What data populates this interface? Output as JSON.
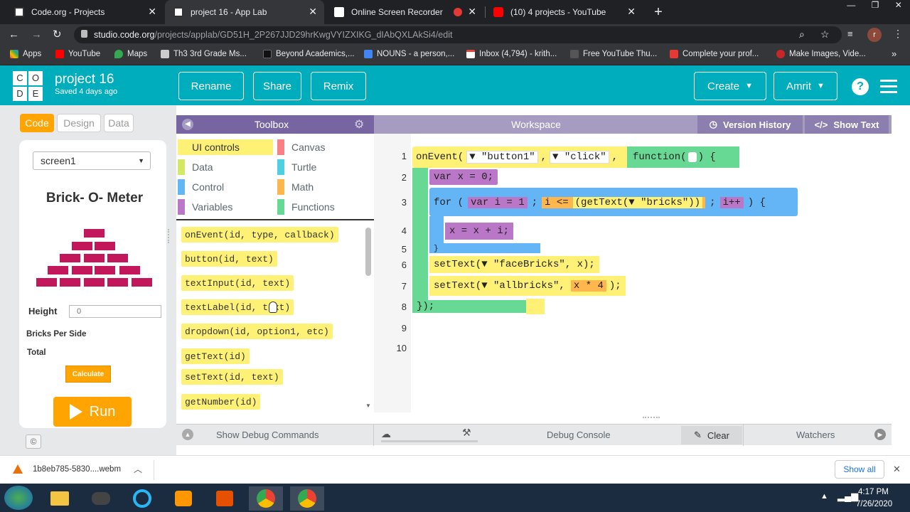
{
  "browser": {
    "tabs": [
      {
        "title": "Code.org - Projects",
        "close": "✕"
      },
      {
        "title": "project 16 - App Lab",
        "close": "✕"
      },
      {
        "title": "Online Screen Recorder",
        "close": "✕"
      },
      {
        "title": "(10) 4 projects - YouTube",
        "close": "✕"
      }
    ],
    "new_tab": "+",
    "url_host": "studio.code.org",
    "url_path": "/projects/applab/GD51H_2P267JJD29hrKwgVYIZXIKG_dIAbQXLAkSi4/edit",
    "profile_initial": "r",
    "bookmarks": [
      "Apps",
      "YouTube",
      "Maps",
      "Th3 3rd Grade Ms...",
      "Beyond Academics,...",
      "NOUNS - a person,...",
      "Inbox (4,794) - krith...",
      "Free YouTube Thu...",
      "Complete your prof...",
      "Make Images, Vide..."
    ]
  },
  "header": {
    "logo_letters": [
      "C",
      "O",
      "D",
      "E"
    ],
    "project_name": "project 16",
    "saved": "Saved 4 days ago",
    "rename": "Rename",
    "share": "Share",
    "remix": "Remix",
    "create": "Create",
    "user": "Amrit",
    "help": "?"
  },
  "modes": {
    "code": "Code",
    "design": "Design",
    "data": "Data"
  },
  "app": {
    "screen_select": "screen1",
    "title": "Brick- O- Meter",
    "height_label": "Height",
    "height_placeholder": "0",
    "bricks_label": "Bricks Per Side",
    "total_label": "Total",
    "calc_button": "Calculate",
    "run": "Run",
    "copyright": "©"
  },
  "toolbox": {
    "title": "Toolbox",
    "categories": [
      {
        "label": "UI controls",
        "color": "#fff176"
      },
      {
        "label": "Data",
        "color": "#d3e965"
      },
      {
        "label": "Control",
        "color": "#64b5f6"
      },
      {
        "label": "Variables",
        "color": "#bb77c7"
      },
      {
        "label": "Canvas",
        "color": "#f78183"
      },
      {
        "label": "Turtle",
        "color": "#4dd0e1"
      },
      {
        "label": "Math",
        "color": "#ffb74d"
      },
      {
        "label": "Functions",
        "color": "#68d995"
      }
    ],
    "blocks": [
      "onEvent(id, type, callback)",
      "button(id, text)",
      "textInput(id, text)",
      "textLabel(id, text)",
      "dropdown(id, option1, etc)",
      "getText(id)",
      "setText(id, text)",
      "getNumber(id)"
    ]
  },
  "workspace": {
    "title": "Workspace",
    "version_history": "Version History",
    "show_text": "Show Text",
    "line_numbers": [
      "1",
      "2",
      "3",
      "4",
      "5",
      "6",
      "7",
      "8",
      "9",
      "10"
    ],
    "code": {
      "l1_event": "onEvent(",
      "l1_id": "▼ \"button1\"",
      "l1_type": "▼ \"click\"",
      "l1_fn": "function(",
      "l1_end": ") {",
      "l2": "var x = 0;",
      "l3_for": "for (",
      "l3_var": "var i = 1",
      "l3_cond_i": "i <=",
      "l3_get": "(getText(▼ \"bricks\"))",
      "l3_inc": "i++",
      "l3_end": ") {",
      "l4": "x = x + i;",
      "l5": "}",
      "l6": "setText(▼ \"faceBricks\", x);",
      "l7a": "setText(▼ \"allbricks\",",
      "l7b": "x * 4",
      "l7c": ");",
      "l8": "});"
    }
  },
  "debug": {
    "show_debug": "Show Debug Commands",
    "console": "Debug Console",
    "clear": "Clear",
    "watchers": "Watchers"
  },
  "downloads": {
    "file": "1b8eb785-5830....webm",
    "show_all": "Show all",
    "close": "✕"
  },
  "taskbar": {
    "time": "4:17 PM",
    "date": "7/26/2020"
  }
}
